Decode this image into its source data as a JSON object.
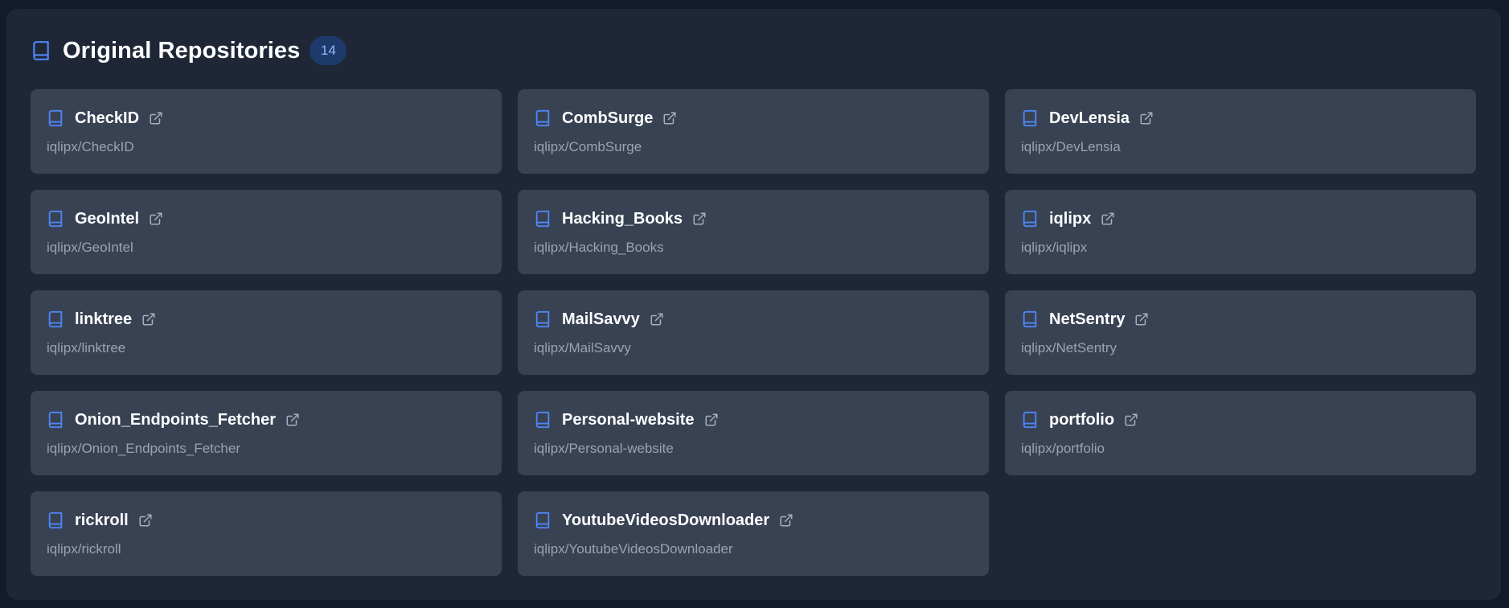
{
  "section": {
    "title": "Original Repositories",
    "count": "14"
  },
  "colors": {
    "accent": "#4f86f7",
    "panel": "#1f2737",
    "card": "#384253",
    "badge_bg": "#1e3a6a"
  },
  "icons": {
    "repo": "book-icon",
    "link": "external-link-icon"
  },
  "repos": [
    {
      "name": "CheckID",
      "path": "iqlipx/CheckID"
    },
    {
      "name": "CombSurge",
      "path": "iqlipx/CombSurge"
    },
    {
      "name": "DevLensia",
      "path": "iqlipx/DevLensia"
    },
    {
      "name": "GeoIntel",
      "path": "iqlipx/GeoIntel"
    },
    {
      "name": "Hacking_Books",
      "path": "iqlipx/Hacking_Books"
    },
    {
      "name": "iqlipx",
      "path": "iqlipx/iqlipx"
    },
    {
      "name": "linktree",
      "path": "iqlipx/linktree"
    },
    {
      "name": "MailSavvy",
      "path": "iqlipx/MailSavvy"
    },
    {
      "name": "NetSentry",
      "path": "iqlipx/NetSentry"
    },
    {
      "name": "Onion_Endpoints_Fetcher",
      "path": "iqlipx/Onion_Endpoints_Fetcher"
    },
    {
      "name": "Personal-website",
      "path": "iqlipx/Personal-website"
    },
    {
      "name": "portfolio",
      "path": "iqlipx/portfolio"
    },
    {
      "name": "rickroll",
      "path": "iqlipx/rickroll"
    },
    {
      "name": "YoutubeVideosDownloader",
      "path": "iqlipx/YoutubeVideosDownloader"
    }
  ]
}
